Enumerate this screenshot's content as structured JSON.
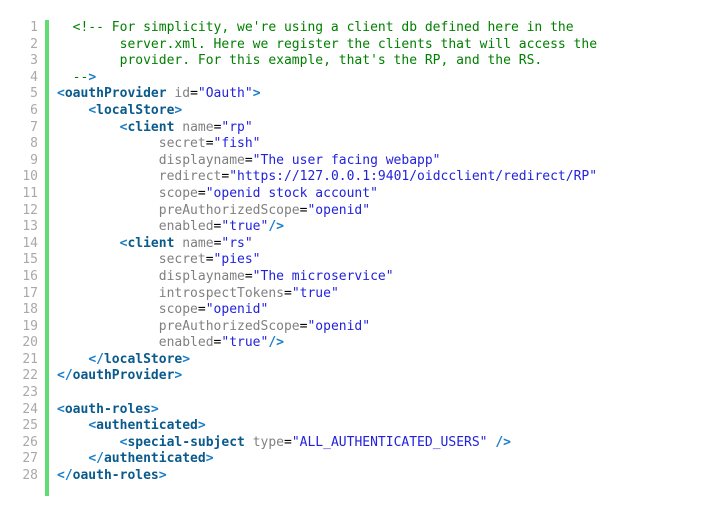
{
  "editor": {
    "language": "xml",
    "background_color": "#ffffff",
    "change_bar_color": "#5fdd74",
    "line_number_color": "#a9a9a9",
    "clipped_top_fragment": "\"",
    "syntax_colors": {
      "comment": "#008000",
      "bracket": "#1a7ec8",
      "tag_name": "#0a5a8c",
      "attribute_name": "#808080",
      "attribute_value": "#2222dd",
      "plain": "#000000"
    },
    "line_numbers": [
      "1",
      "2",
      "3",
      "4",
      "5",
      "6",
      "7",
      "8",
      "9",
      "10",
      "11",
      "12",
      "13",
      "14",
      "15",
      "16",
      "17",
      "18",
      "19",
      "20",
      "21",
      "22",
      "23",
      "24",
      "25",
      "26",
      "27",
      "28"
    ],
    "lines": [
      {
        "number": "1",
        "tokens": [
          {
            "t": "plain",
            "v": "  "
          },
          {
            "t": "comment",
            "v": "<!-- For simplicity, we're using a client db defined here in the"
          }
        ]
      },
      {
        "number": "2",
        "tokens": [
          {
            "t": "comment",
            "v": "        server.xml. Here we register the clients that will access the"
          }
        ]
      },
      {
        "number": "3",
        "tokens": [
          {
            "t": "comment",
            "v": "        provider. For this example, that's the RP, and the RS."
          }
        ]
      },
      {
        "number": "4",
        "tokens": [
          {
            "t": "plain",
            "v": "  "
          },
          {
            "t": "comment",
            "v": "--"
          },
          {
            "t": "bracket",
            "v": ">"
          }
        ]
      },
      {
        "number": "5",
        "tokens": [
          {
            "t": "bracket",
            "v": "<"
          },
          {
            "t": "tagname",
            "v": "oauthProvider"
          },
          {
            "t": "plain",
            "v": " "
          },
          {
            "t": "attrname",
            "v": "id"
          },
          {
            "t": "plain",
            "v": "="
          },
          {
            "t": "attrvalue",
            "v": "\"Oauth\""
          },
          {
            "t": "bracket",
            "v": ">"
          }
        ]
      },
      {
        "number": "6",
        "tokens": [
          {
            "t": "plain",
            "v": "    "
          },
          {
            "t": "bracket",
            "v": "<"
          },
          {
            "t": "tagname",
            "v": "localStore"
          },
          {
            "t": "bracket",
            "v": ">"
          }
        ]
      },
      {
        "number": "7",
        "tokens": [
          {
            "t": "plain",
            "v": "        "
          },
          {
            "t": "bracket",
            "v": "<"
          },
          {
            "t": "tagname",
            "v": "client"
          },
          {
            "t": "plain",
            "v": " "
          },
          {
            "t": "attrname",
            "v": "name"
          },
          {
            "t": "plain",
            "v": "="
          },
          {
            "t": "attrvalue",
            "v": "\"rp\""
          }
        ]
      },
      {
        "number": "8",
        "tokens": [
          {
            "t": "plain",
            "v": "             "
          },
          {
            "t": "attrname",
            "v": "secret"
          },
          {
            "t": "plain",
            "v": "="
          },
          {
            "t": "attrvalue",
            "v": "\"fish\""
          }
        ]
      },
      {
        "number": "9",
        "tokens": [
          {
            "t": "plain",
            "v": "             "
          },
          {
            "t": "attrname",
            "v": "displayname"
          },
          {
            "t": "plain",
            "v": "="
          },
          {
            "t": "attrvalue",
            "v": "\"The user facing webapp\""
          }
        ]
      },
      {
        "number": "10",
        "tokens": [
          {
            "t": "plain",
            "v": "             "
          },
          {
            "t": "attrname",
            "v": "redirect"
          },
          {
            "t": "plain",
            "v": "="
          },
          {
            "t": "attrvalue",
            "v": "\"https://127.0.0.1:9401/oidcclient/redirect/RP\""
          }
        ]
      },
      {
        "number": "11",
        "tokens": [
          {
            "t": "plain",
            "v": "             "
          },
          {
            "t": "attrname",
            "v": "scope"
          },
          {
            "t": "plain",
            "v": "="
          },
          {
            "t": "attrvalue",
            "v": "\"openid stock account\""
          }
        ]
      },
      {
        "number": "12",
        "tokens": [
          {
            "t": "plain",
            "v": "             "
          },
          {
            "t": "attrname",
            "v": "preAuthorizedScope"
          },
          {
            "t": "plain",
            "v": "="
          },
          {
            "t": "attrvalue",
            "v": "\"openid\""
          }
        ]
      },
      {
        "number": "13",
        "tokens": [
          {
            "t": "plain",
            "v": "             "
          },
          {
            "t": "attrname",
            "v": "enabled"
          },
          {
            "t": "plain",
            "v": "="
          },
          {
            "t": "attrvalue",
            "v": "\"true\""
          },
          {
            "t": "bracket",
            "v": "/>"
          }
        ]
      },
      {
        "number": "14",
        "tokens": [
          {
            "t": "plain",
            "v": "        "
          },
          {
            "t": "bracket",
            "v": "<"
          },
          {
            "t": "tagname",
            "v": "client"
          },
          {
            "t": "plain",
            "v": " "
          },
          {
            "t": "attrname",
            "v": "name"
          },
          {
            "t": "plain",
            "v": "="
          },
          {
            "t": "attrvalue",
            "v": "\"rs\""
          }
        ]
      },
      {
        "number": "15",
        "tokens": [
          {
            "t": "plain",
            "v": "             "
          },
          {
            "t": "attrname",
            "v": "secret"
          },
          {
            "t": "plain",
            "v": "="
          },
          {
            "t": "attrvalue",
            "v": "\"pies\""
          }
        ]
      },
      {
        "number": "16",
        "tokens": [
          {
            "t": "plain",
            "v": "             "
          },
          {
            "t": "attrname",
            "v": "displayname"
          },
          {
            "t": "plain",
            "v": "="
          },
          {
            "t": "attrvalue",
            "v": "\"The microservice\""
          }
        ]
      },
      {
        "number": "17",
        "tokens": [
          {
            "t": "plain",
            "v": "             "
          },
          {
            "t": "attrname",
            "v": "introspectTokens"
          },
          {
            "t": "plain",
            "v": "="
          },
          {
            "t": "attrvalue",
            "v": "\"true\""
          }
        ]
      },
      {
        "number": "18",
        "tokens": [
          {
            "t": "plain",
            "v": "             "
          },
          {
            "t": "attrname",
            "v": "scope"
          },
          {
            "t": "plain",
            "v": "="
          },
          {
            "t": "attrvalue",
            "v": "\"openid\""
          }
        ]
      },
      {
        "number": "19",
        "tokens": [
          {
            "t": "plain",
            "v": "             "
          },
          {
            "t": "attrname",
            "v": "preAuthorizedScope"
          },
          {
            "t": "plain",
            "v": "="
          },
          {
            "t": "attrvalue",
            "v": "\"openid\""
          }
        ]
      },
      {
        "number": "20",
        "tokens": [
          {
            "t": "plain",
            "v": "             "
          },
          {
            "t": "attrname",
            "v": "enabled"
          },
          {
            "t": "plain",
            "v": "="
          },
          {
            "t": "attrvalue",
            "v": "\"true\""
          },
          {
            "t": "bracket",
            "v": "/>"
          }
        ]
      },
      {
        "number": "21",
        "tokens": [
          {
            "t": "plain",
            "v": "    "
          },
          {
            "t": "bracket",
            "v": "</"
          },
          {
            "t": "tagname",
            "v": "localStore"
          },
          {
            "t": "bracket",
            "v": ">"
          }
        ]
      },
      {
        "number": "22",
        "tokens": [
          {
            "t": "bracket",
            "v": "</"
          },
          {
            "t": "tagname",
            "v": "oauthProvider"
          },
          {
            "t": "bracket",
            "v": ">"
          }
        ]
      },
      {
        "number": "23",
        "tokens": [
          {
            "t": "plain",
            "v": ""
          }
        ]
      },
      {
        "number": "24",
        "tokens": [
          {
            "t": "bracket",
            "v": "<"
          },
          {
            "t": "tagname",
            "v": "oauth-roles"
          },
          {
            "t": "bracket",
            "v": ">"
          }
        ]
      },
      {
        "number": "25",
        "tokens": [
          {
            "t": "plain",
            "v": "    "
          },
          {
            "t": "bracket",
            "v": "<"
          },
          {
            "t": "tagname",
            "v": "authenticated"
          },
          {
            "t": "bracket",
            "v": ">"
          }
        ]
      },
      {
        "number": "26",
        "tokens": [
          {
            "t": "plain",
            "v": "        "
          },
          {
            "t": "bracket",
            "v": "<"
          },
          {
            "t": "tagname",
            "v": "special-subject"
          },
          {
            "t": "plain",
            "v": " "
          },
          {
            "t": "attrname",
            "v": "type"
          },
          {
            "t": "plain",
            "v": "="
          },
          {
            "t": "attrvalue",
            "v": "\"ALL_AUTHENTICATED_USERS\""
          },
          {
            "t": "plain",
            "v": " "
          },
          {
            "t": "bracket",
            "v": "/>"
          }
        ]
      },
      {
        "number": "27",
        "tokens": [
          {
            "t": "plain",
            "v": "    "
          },
          {
            "t": "bracket",
            "v": "</"
          },
          {
            "t": "tagname",
            "v": "authenticated"
          },
          {
            "t": "bracket",
            "v": ">"
          }
        ]
      },
      {
        "number": "28",
        "tokens": [
          {
            "t": "bracket",
            "v": "</"
          },
          {
            "t": "tagname",
            "v": "oauth-roles"
          },
          {
            "t": "bracket",
            "v": ">"
          }
        ]
      }
    ]
  }
}
